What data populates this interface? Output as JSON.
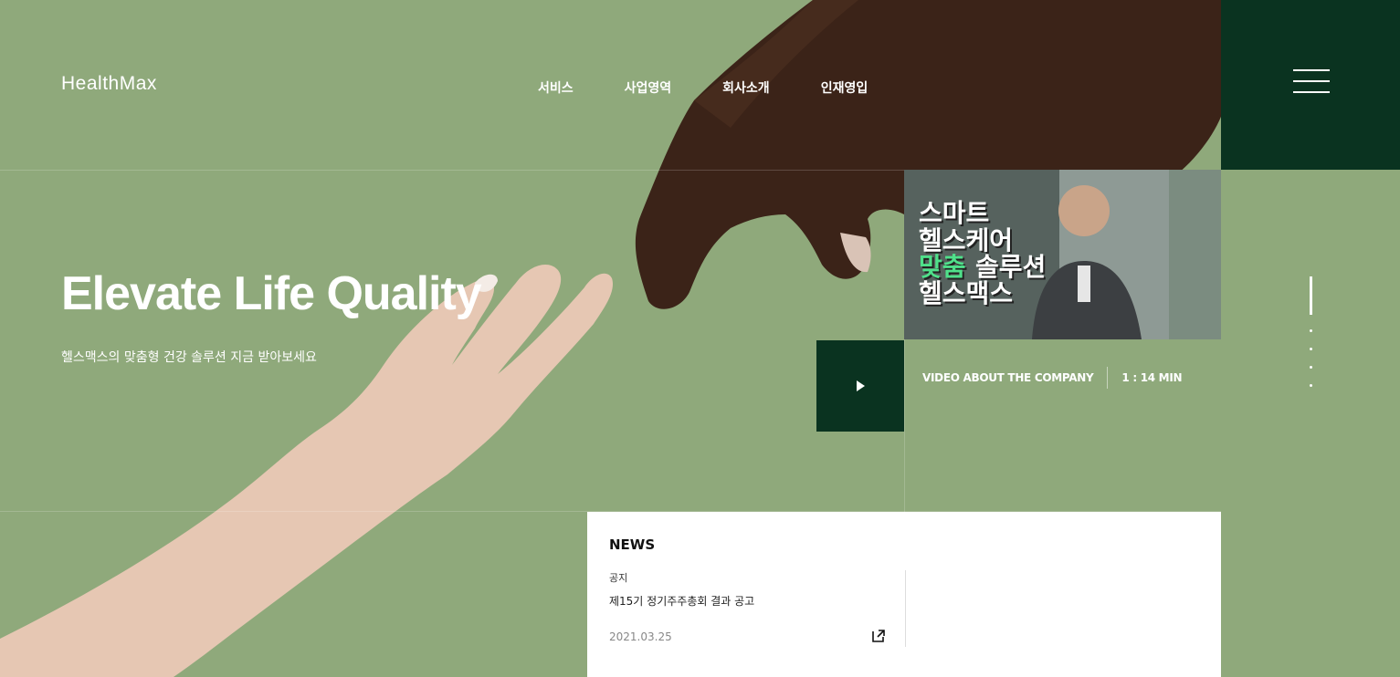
{
  "header": {
    "logo": "HealthMax",
    "nav": [
      "서비스",
      "사업영역",
      "회사소개",
      "인재영입"
    ]
  },
  "hero": {
    "title": "Elevate Life Quality",
    "subtitle": "헬스맥스의 맞춤형 건강 솔루션 지금 받아보세요"
  },
  "video": {
    "thumb_lines": [
      "스마트",
      "헬스케어",
      "맞춤",
      "솔루션",
      "헬스맥스"
    ],
    "label": "VIDEO ABOUT THE COMPANY",
    "duration": "1 : 14 MIN",
    "highlight_color": "#4fe08a"
  },
  "news": {
    "title": "NEWS",
    "category": "공지",
    "headline": "제15기 정기주주총회 결과 공고",
    "date": "2021.03.25"
  },
  "colors": {
    "background": "#8fa97b",
    "dark_green": "#0a3320",
    "white": "#ffffff"
  },
  "icons": [
    "menu-icon",
    "play-icon",
    "external-link-icon"
  ]
}
